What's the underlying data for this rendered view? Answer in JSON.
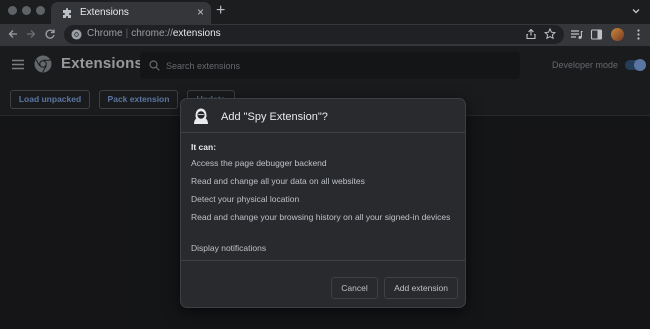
{
  "tab": {
    "title": "Extensions",
    "close": "×",
    "new_tab": "+"
  },
  "omnibox": {
    "label": "Chrome",
    "separator": "|",
    "scheme": "chrome://",
    "host": "extensions"
  },
  "header": {
    "title": "Extensions",
    "search_placeholder": "Search extensions",
    "developer_mode_label": "Developer mode",
    "developer_mode_on": true
  },
  "actions": {
    "load_unpacked": "Load unpacked",
    "pack_extension": "Pack extension",
    "update": "Update"
  },
  "dialog": {
    "title": "Add \"Spy Extension\"?",
    "it_can": "It can:",
    "permissions": [
      "Access the page debugger backend",
      "Read and change all your data on all websites",
      "Detect your physical location",
      "Read and change your browsing history on all your signed-in devices",
      "Display notifications"
    ],
    "cancel": "Cancel",
    "add": "Add extension"
  },
  "colors": {
    "accent": "#8ab4f8",
    "background": "#202124",
    "surface": "#292a2d",
    "text": "#e8eaed",
    "muted": "#9aa0a6"
  },
  "icons": {
    "tab": "puzzle-icon",
    "omnibox": "chrome-icon",
    "menu": "hamburger-icon",
    "search": "search-icon",
    "extension": "spy-hacker-icon"
  }
}
